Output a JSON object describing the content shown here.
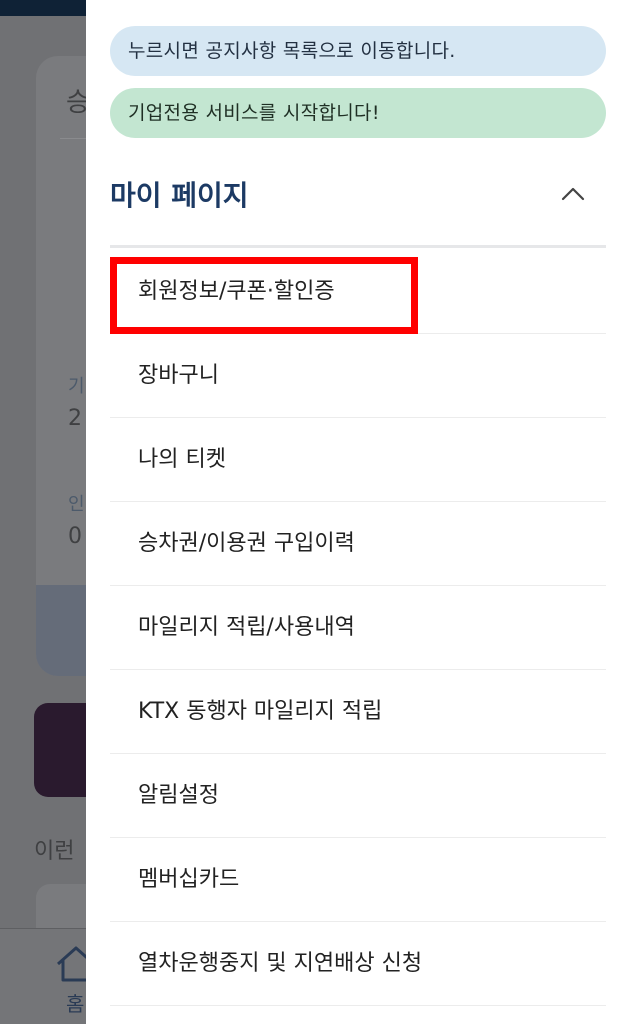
{
  "background": {
    "card_heading": "승",
    "label_1": "기",
    "value_1": "2",
    "label_2": "인",
    "value_2": "0",
    "section_text": "이런",
    "tab_home_label": "홈"
  },
  "drawer": {
    "notice_blue": "누르시면 공지사항 목록으로 이동합니다.",
    "notice_green": "기업전용 서비스를 시작합니다!",
    "section_title": "마이 페이지",
    "menu": [
      "회원정보/쿠폰·할인증",
      "장바구니",
      "나의 티켓",
      "승차권/이용권 구입이력",
      "마일리지 적립/사용내역",
      "KTX 동행자 마일리지 적립",
      "알림설정",
      "멤버십카드",
      "열차운행중지 및 지연배상 신청"
    ]
  },
  "colors": {
    "notice_blue_bg": "#d6e7f3",
    "notice_green_bg": "#c3e6d1",
    "title_color": "#1c3a64",
    "highlight_border": "#ff0000"
  }
}
